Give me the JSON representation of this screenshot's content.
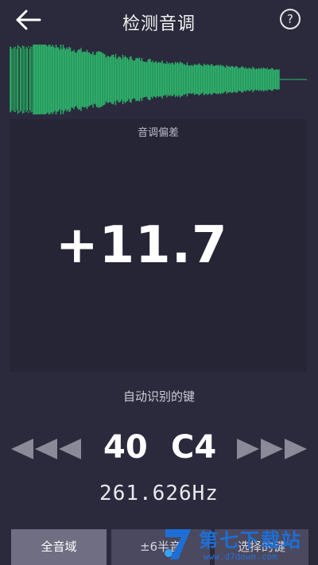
{
  "header": {
    "title": "检测音调",
    "help_label": "?"
  },
  "waveform": {
    "color": "#2db36b"
  },
  "deviation_panel": {
    "label": "音调偏差",
    "value": "+11.7"
  },
  "key_detection": {
    "label": "自动识别的键",
    "key_number": "40",
    "key_name": "C4",
    "frequency": "261.626Hz",
    "arrow_color": "#8a8a99"
  },
  "range_buttons": {
    "full_range": "全音域",
    "six_semitones": "±6半音",
    "selected_key": "选择的键"
  },
  "watermark": {
    "title": "第七下载站",
    "url": "www.d7down.com"
  }
}
